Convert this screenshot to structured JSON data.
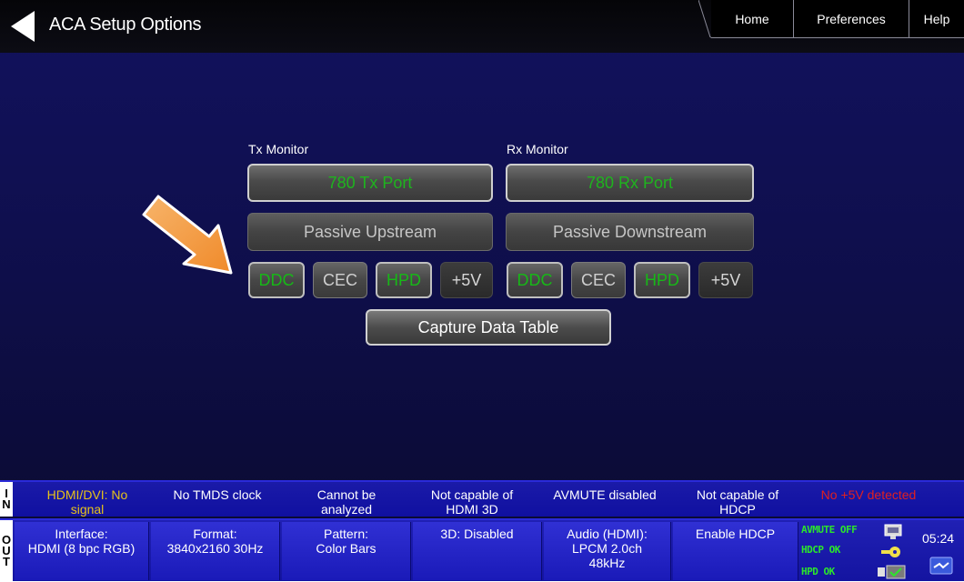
{
  "header": {
    "title": "ACA Setup Options",
    "tabs": [
      "Home",
      "Preferences",
      "Help"
    ]
  },
  "tx": {
    "label": "Tx Monitor",
    "port": "780 Tx Port",
    "passive": "Passive Upstream",
    "buttons": [
      "DDC",
      "CEC",
      "HPD",
      "+5V"
    ]
  },
  "rx": {
    "label": "Rx Monitor",
    "port": "780 Rx Port",
    "passive": "Passive Downstream",
    "buttons": [
      "DDC",
      "CEC",
      "HPD",
      "+5V"
    ]
  },
  "capture": "Capture Data Table",
  "in_status": {
    "side": [
      "I",
      "N"
    ],
    "cells": [
      [
        "HDMI/DVI: No",
        "signal"
      ],
      [
        "No TMDS clock"
      ],
      [
        "Cannot be",
        "analyzed"
      ],
      [
        "Not capable of",
        "HDMI 3D"
      ],
      [
        "AVMUTE disabled"
      ],
      [
        "Not capable of",
        "HDCP"
      ],
      [
        "No +5V detected"
      ]
    ]
  },
  "out_status": {
    "side": [
      "O",
      "U",
      "T"
    ],
    "cells": [
      [
        "Interface:",
        "HDMI (8 bpc RGB)"
      ],
      [
        "Format:",
        "3840x2160 30Hz"
      ],
      [
        "Pattern:",
        "Color Bars"
      ],
      [
        "3D: Disabled"
      ],
      [
        "Audio (HDMI):",
        "LPCM 2.0ch",
        "48kHz"
      ],
      [
        "Enable HDCP"
      ]
    ],
    "indicators": [
      "AVMUTE OFF",
      "HDCP OK",
      "HPD OK"
    ],
    "clock": "05:24"
  },
  "colors": {
    "active_green": "#1eb41e",
    "warning_yellow": "#e6c21a",
    "error_red": "#e02020",
    "arrow_orange": "#f5a04a"
  }
}
